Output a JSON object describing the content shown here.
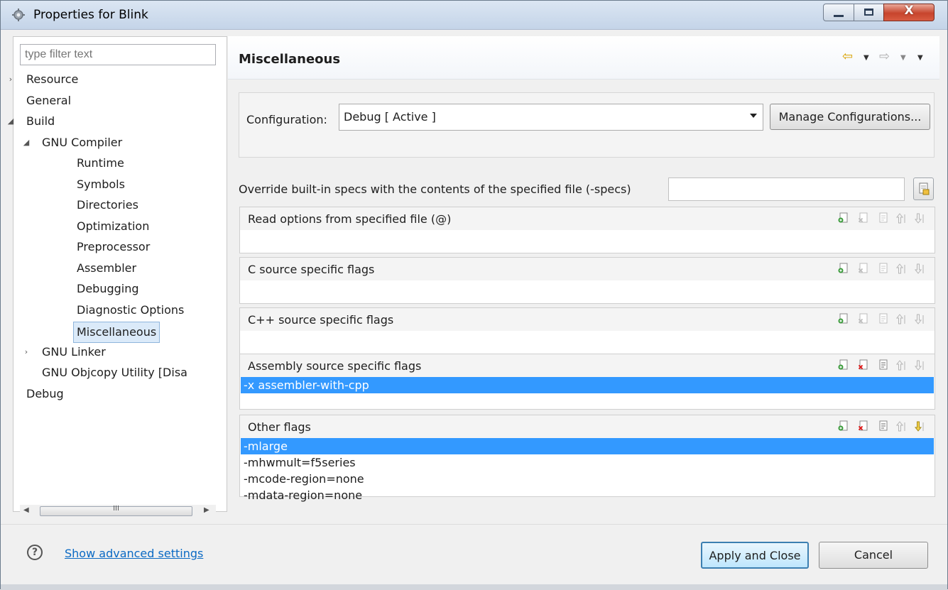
{
  "window": {
    "title": "Properties for Blink",
    "close_glyph": "X",
    "icons": {
      "app": "gear-icon",
      "minimize": "minimize-icon",
      "maximize": "maximize-icon",
      "close": "close-icon"
    }
  },
  "left": {
    "filter_placeholder": "type filter text",
    "tree": [
      {
        "label": "Resource",
        "level": 0,
        "twisty": "collapsed"
      },
      {
        "label": "General",
        "level": 0,
        "twisty": "none"
      },
      {
        "label": "Build",
        "level": 0,
        "twisty": "expanded"
      },
      {
        "label": "GNU Compiler",
        "level": 1,
        "twisty": "expanded"
      },
      {
        "label": "Runtime",
        "level": 2,
        "twisty": "none"
      },
      {
        "label": "Symbols",
        "level": 2,
        "twisty": "none"
      },
      {
        "label": "Directories",
        "level": 2,
        "twisty": "none"
      },
      {
        "label": "Optimization",
        "level": 2,
        "twisty": "none"
      },
      {
        "label": "Preprocessor",
        "level": 2,
        "twisty": "none"
      },
      {
        "label": "Assembler",
        "level": 2,
        "twisty": "none"
      },
      {
        "label": "Debugging",
        "level": 2,
        "twisty": "none"
      },
      {
        "label": "Diagnostic Options",
        "level": 2,
        "twisty": "none"
      },
      {
        "label": "Miscellaneous",
        "level": 2,
        "twisty": "none",
        "selected": true
      },
      {
        "label": "GNU Linker",
        "level": 1,
        "twisty": "collapsed"
      },
      {
        "label": "GNU Objcopy Utility  [Disa",
        "level": 1,
        "twisty": "none"
      },
      {
        "label": "Debug",
        "level": 0,
        "twisty": "none"
      }
    ],
    "scroll_grip": "III"
  },
  "main": {
    "title": "Miscellaneous",
    "nav_icons": [
      "back-arrow-icon",
      "back-menu-icon",
      "forward-arrow-icon",
      "forward-menu-icon",
      "view-menu-icon"
    ],
    "configuration_label": "Configuration:",
    "configuration_value": "Debug  [ Active ]",
    "manage_button": "Manage Configurations...",
    "specs_label": "Override built-in specs with the contents of the specified file (-specs)",
    "specs_value": "",
    "groups": [
      {
        "title": "Read options from specified file (@)",
        "items": [],
        "selected": -1,
        "delete_enabled": false
      },
      {
        "title": "C source specific flags",
        "items": [],
        "selected": -1,
        "delete_enabled": false
      },
      {
        "title": "C++ source specific flags",
        "items": [],
        "selected": -1,
        "delete_enabled": false
      },
      {
        "title": "Assembly source specific flags",
        "items": [
          "-x assembler-with-cpp"
        ],
        "selected": 0,
        "delete_enabled": true
      },
      {
        "title": "Other flags",
        "items": [
          "-mlarge",
          "-mhwmult=f5series",
          "-mcode-region=none",
          "-mdata-region=none"
        ],
        "selected": 0,
        "delete_enabled": true
      }
    ],
    "group_tool_icons": [
      "add-icon",
      "delete-icon",
      "edit-icon",
      "move-up-icon",
      "move-down-icon"
    ]
  },
  "footer": {
    "help_glyph": "?",
    "advanced_link": "Show advanced settings",
    "apply_button": "Apply and Close",
    "cancel_button": "Cancel"
  },
  "colors": {
    "selection": "#3399ff",
    "link": "#0b6ac4"
  }
}
